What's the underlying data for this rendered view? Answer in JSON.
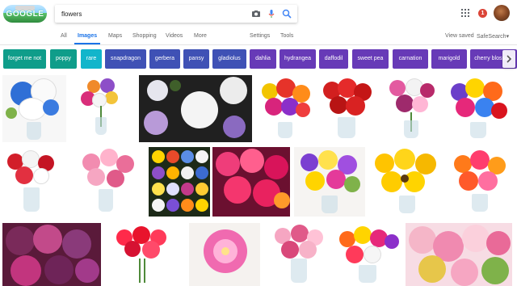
{
  "search": {
    "query": "flowers"
  },
  "logo": {
    "text": "GOOGLE"
  },
  "header": {
    "notification_count": "1"
  },
  "tabs": {
    "items": [
      {
        "label": "All"
      },
      {
        "label": "Images"
      },
      {
        "label": "Maps"
      },
      {
        "label": "Shopping"
      },
      {
        "label": "Videos"
      },
      {
        "label": "More"
      }
    ],
    "settings": "Settings",
    "tools": "Tools",
    "view_saved": "View saved",
    "safesearch": "SafeSearch"
  },
  "chips": [
    {
      "label": "forget me not",
      "color": "#0f9d8a"
    },
    {
      "label": "poppy",
      "color": "#0f9d8a"
    },
    {
      "label": "rare",
      "color": "#12b5cb"
    },
    {
      "label": "snapdragon",
      "color": "#3f51b5"
    },
    {
      "label": "gerbera",
      "color": "#3f51b5"
    },
    {
      "label": "pansy",
      "color": "#3f51b5"
    },
    {
      "label": "gladiolus",
      "color": "#3f51b5"
    },
    {
      "label": "dahlia",
      "color": "#673ab7"
    },
    {
      "label": "hydrangea",
      "color": "#673ab7"
    },
    {
      "label": "daffodil",
      "color": "#673ab7"
    },
    {
      "label": "sweet pea",
      "color": "#673ab7"
    },
    {
      "label": "carnation",
      "color": "#673ab7"
    },
    {
      "label": "marigold",
      "color": "#673ab7"
    },
    {
      "label": "cherry blossom",
      "color": "#673ab7"
    }
  ],
  "images": [
    {
      "name": "white-blue-bouquet"
    },
    {
      "name": "mixed-lily-bouquet"
    },
    {
      "name": "white-rose-closeup"
    },
    {
      "name": "bright-mixed-bouquet"
    },
    {
      "name": "red-roses-bouquet"
    },
    {
      "name": "pink-lily-bouquet"
    },
    {
      "name": "rainbow-gerbera-bouquet"
    },
    {
      "name": "red-lily-vase"
    },
    {
      "name": "pink-lily-vase"
    },
    {
      "name": "flower-grid"
    },
    {
      "name": "pink-zinnia-closeup"
    },
    {
      "name": "purple-yellow-bouquet"
    },
    {
      "name": "sunflower-bouquet"
    },
    {
      "name": "orange-gerbera-bouquet"
    },
    {
      "name": "purple-rose-fabric"
    },
    {
      "name": "red-gerbera-bunch"
    },
    {
      "name": "pink-dahlia"
    },
    {
      "name": "pink-rose-vase"
    },
    {
      "name": "colorful-bouquet-vase"
    },
    {
      "name": "pink-rose-closeup"
    }
  ]
}
